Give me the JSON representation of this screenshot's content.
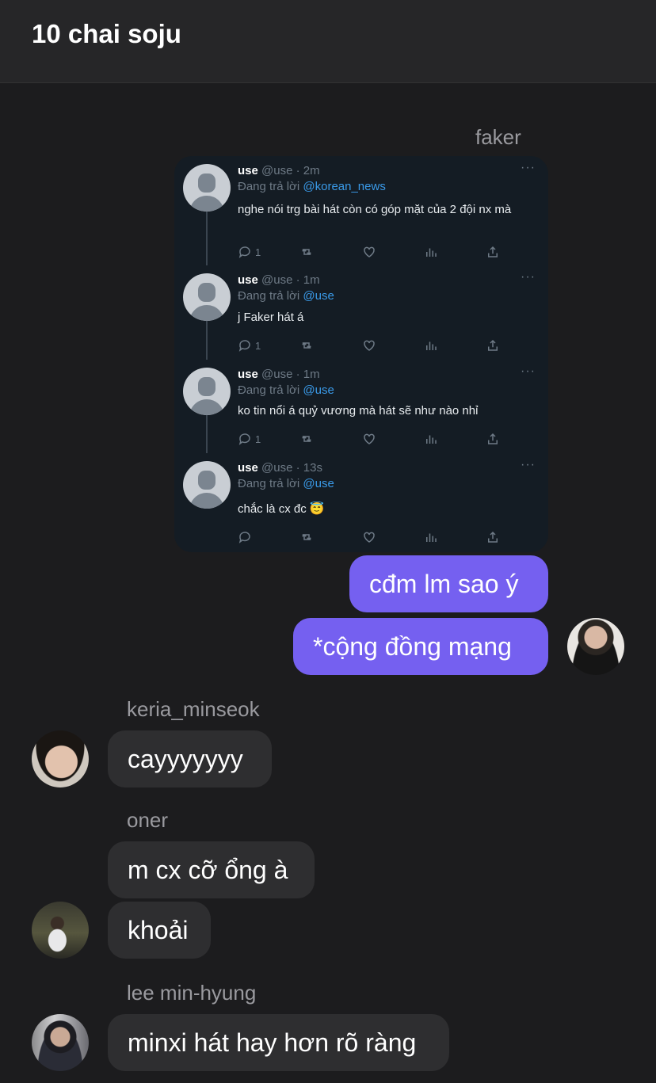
{
  "header": {
    "title": "10 chai soju"
  },
  "faker_block": {
    "sender": "faker",
    "tweets": [
      {
        "name": "use",
        "meta": "@use · 2m",
        "reply_prefix": "Đang trả lời",
        "reply_to": "@korean_news",
        "text": "nghe nói trg bài hát còn có góp mặt của 2 đội nx mà",
        "reply_count": "1"
      },
      {
        "name": "use",
        "meta": "@use · 1m",
        "reply_prefix": "Đang trả lời",
        "reply_to": "@use",
        "text": "j Faker hát á",
        "reply_count": "1"
      },
      {
        "name": "use",
        "meta": "@use · 1m",
        "reply_prefix": "Đang trả lời",
        "reply_to": "@use",
        "text": "ko tin nổi á quỷ vương mà hát sẽ như nào nhỉ",
        "reply_count": "1"
      },
      {
        "name": "use",
        "meta": "@use · 13s",
        "reply_prefix": "Đang trả lời",
        "reply_to": "@use",
        "text": "chắc là cx đc 😇",
        "reply_count": ""
      }
    ],
    "more": "···",
    "messages": [
      "cđm lm sao ý",
      "*cộng đồng mạng"
    ]
  },
  "keria_block": {
    "sender": "keria_minseok",
    "messages": [
      "cayyyyyyy"
    ]
  },
  "oner_block": {
    "sender": "oner",
    "messages": [
      "m cx cỡ ổng à",
      "khoải"
    ]
  },
  "lee_block": {
    "sender": "lee min-hyung",
    "messages": [
      "minxi hát hay hơn rõ ràng"
    ]
  },
  "colors": {
    "outgoing": "#7560f0",
    "incoming": "#2e2e30",
    "background": "#1c1c1e",
    "mention": "#3a9ae8"
  },
  "icons": [
    "reply-icon",
    "retweet-icon",
    "like-icon",
    "views-icon",
    "share-icon"
  ]
}
